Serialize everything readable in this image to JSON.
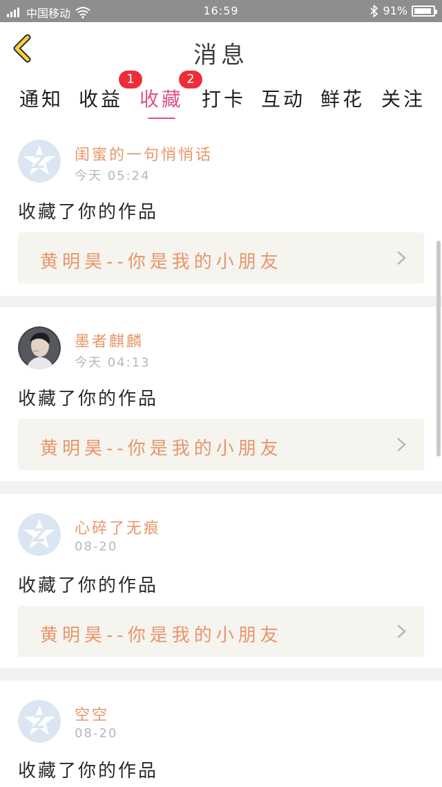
{
  "status_bar": {
    "carrier": "中国移动",
    "time": "16:59",
    "battery_percent": "91%",
    "battery_level": 0.91
  },
  "header": {
    "title": "消息"
  },
  "tabs": [
    {
      "label": "通知",
      "active": false,
      "badge": ""
    },
    {
      "label": "收益",
      "active": false,
      "badge": "1"
    },
    {
      "label": "收藏",
      "active": true,
      "badge": "2"
    },
    {
      "label": "打卡",
      "active": false,
      "badge": ""
    },
    {
      "label": "互动",
      "active": false,
      "badge": ""
    },
    {
      "label": "鲜花",
      "active": false,
      "badge": ""
    },
    {
      "label": "关注",
      "active": false,
      "badge": ""
    }
  ],
  "notifications": [
    {
      "username": "闺蜜的一句悄悄话",
      "time": "今天 05:24",
      "action": "收藏了你的作品",
      "work_title": "黄明昊--你是我的小朋友",
      "avatar": "default-avatar"
    },
    {
      "username": "墨者麒麟",
      "time": "今天 04:13",
      "action": "收藏了你的作品",
      "work_title": "黄明昊--你是我的小朋友",
      "avatar": "photo-avatar"
    },
    {
      "username": "心碎了无痕",
      "time": "08-20",
      "action": "收藏了你的作品",
      "work_title": "黄明昊--你是我的小朋友",
      "avatar": "default-avatar"
    },
    {
      "username": "空空",
      "time": "08-20",
      "action": "收藏了你的作品",
      "work_title": "",
      "avatar": "default-avatar"
    }
  ],
  "colors": {
    "accent": "#e2508a",
    "username": "#e8956a",
    "badge": "#ee2d3b",
    "back_arrow": "#f2cf45"
  }
}
